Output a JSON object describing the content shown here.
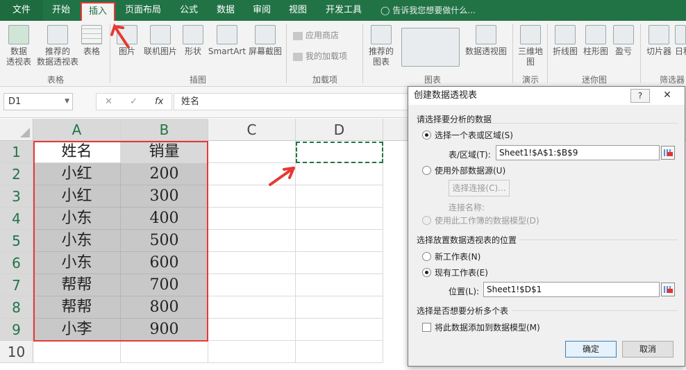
{
  "ribbon": {
    "tabs": [
      "文件",
      "开始",
      "插入",
      "页面布局",
      "公式",
      "数据",
      "审阅",
      "视图",
      "开发工具"
    ],
    "active_tab": "插入",
    "tell_me": "告诉我您想要做什么...",
    "groups": {
      "tables": {
        "label": "表格",
        "pivot": "数据\n透视表",
        "recommended_pivot": "推荐的\n数据透视表",
        "table": "表格"
      },
      "illustrations": {
        "label": "插图",
        "picture": "图片",
        "online_picture": "联机图片",
        "shapes": "形状",
        "smartart": "SmartArt",
        "screenshot": "屏幕截图"
      },
      "addins": {
        "label": "加载项",
        "store": "应用商店",
        "my_addins": "我的加载项"
      },
      "charts": {
        "label": "图表",
        "recommended": "推荐的\n图表",
        "pivot_chart": "数据透视图"
      },
      "tours": {
        "label": "演示",
        "map3d": "三维地\n图"
      },
      "sparklines": {
        "label": "迷你图",
        "line": "折线图",
        "column": "柱形图",
        "winloss": "盈亏"
      },
      "filters": {
        "label": "筛选器",
        "slicer": "切片器",
        "timeline": "日程"
      }
    }
  },
  "formula_bar": {
    "name_box": "D1",
    "cancel": "✕",
    "enter": "✓",
    "fx": "fx",
    "value": "姓名"
  },
  "sheet": {
    "columns": [
      "A",
      "B",
      "C",
      "D"
    ],
    "rows": [
      "1",
      "2",
      "3",
      "4",
      "5",
      "6",
      "7",
      "8",
      "9",
      "10"
    ],
    "data": [
      [
        "姓名",
        "销量"
      ],
      [
        "小红",
        "200"
      ],
      [
        "小红",
        "300"
      ],
      [
        "小东",
        "400"
      ],
      [
        "小东",
        "500"
      ],
      [
        "小东",
        "600"
      ],
      [
        "帮帮",
        "700"
      ],
      [
        "帮帮",
        "800"
      ],
      [
        "小李",
        "900"
      ]
    ]
  },
  "dialog": {
    "title": "创建数据透视表",
    "help": "?",
    "close": "✕",
    "section1": "请选择要分析的数据",
    "opt_range": "选择一个表或区域(S)",
    "range_label": "表/区域(T):",
    "range_value": "Sheet1!$A$1:$B$9",
    "opt_external": "使用外部数据源(U)",
    "choose_conn": "选择连接(C)...",
    "conn_name": "连接名称:",
    "opt_model": "使用此工作簿的数据模型(D)",
    "section2": "选择放置数据透视表的位置",
    "opt_new": "新工作表(N)",
    "opt_existing": "现有工作表(E)",
    "location_label": "位置(L):",
    "location_value": "Sheet1!$D$1",
    "section3": "选择是否想要分析多个表",
    "add_to_model": "将此数据添加到数据模型(M)",
    "ok": "确定",
    "cancel": "取消"
  }
}
